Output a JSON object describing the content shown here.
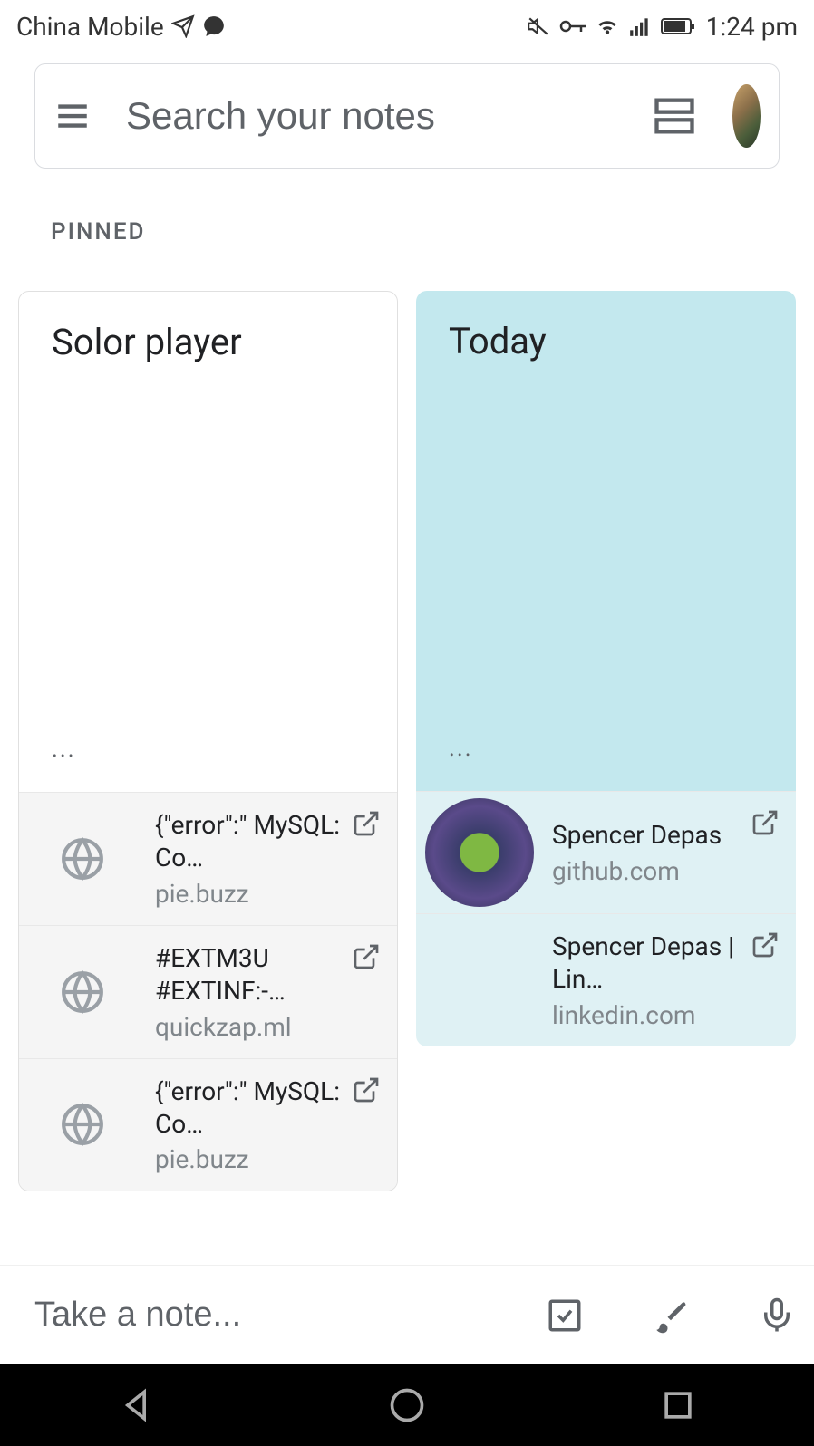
{
  "status": {
    "carrier": "China Mobile",
    "time": "1:24 pm"
  },
  "search": {
    "placeholder": "Search your notes"
  },
  "section_label": "PINNED",
  "notes": [
    {
      "title": "Solor player",
      "ellipsis": "...",
      "color": "white",
      "links": [
        {
          "title": "{\"error\":\" MySQL: Co…",
          "domain": "pie.buzz",
          "icon": "globe"
        },
        {
          "title": "#EXTM3U #EXTINF:-…",
          "domain": "quickzap.ml",
          "icon": "globe"
        },
        {
          "title": "{\"error\":\" MySQL: Co…",
          "domain": "pie.buzz",
          "icon": "globe"
        }
      ]
    },
    {
      "title": "Today",
      "ellipsis": "...",
      "color": "blue",
      "links": [
        {
          "title": "Spencer Depas",
          "domain": "github.com",
          "icon": "avatar"
        },
        {
          "title": "Spencer Depas | Lin…",
          "domain": "linkedin.com",
          "icon": "blank"
        }
      ]
    }
  ],
  "bottom": {
    "placeholder": "Take a note..."
  }
}
